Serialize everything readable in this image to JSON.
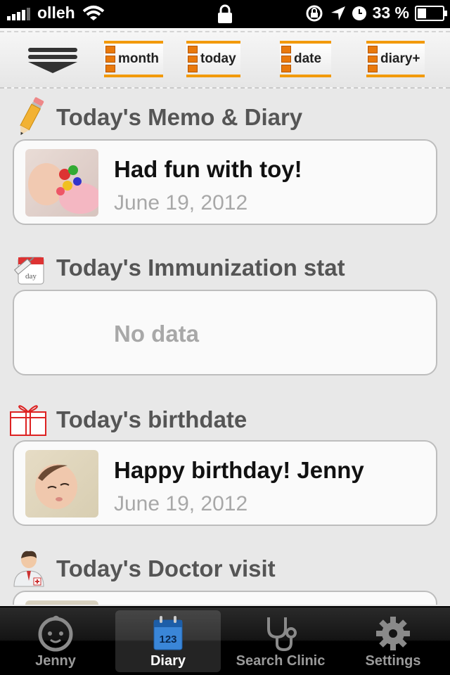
{
  "status_bar": {
    "carrier": "olleh",
    "battery": "33 %"
  },
  "toolbar": {
    "menu_icon": "menu-arrow-icon",
    "buttons": [
      {
        "label": "month"
      },
      {
        "label": "today"
      },
      {
        "label": "date"
      },
      {
        "label": "diary+"
      }
    ]
  },
  "sections": [
    {
      "title": "Today's Memo & Diary",
      "icon": "pencil-icon",
      "card": {
        "title": "Had fun with toy!",
        "date": "June 19, 2012"
      }
    },
    {
      "title": "Today's Immunization stat",
      "icon": "calendar-syringe-icon",
      "card": {
        "empty_text": "No data"
      }
    },
    {
      "title": "Today's birthdate",
      "icon": "gift-icon",
      "card": {
        "title": "Happy birthday! Jenny",
        "date": "June 19, 2012"
      }
    },
    {
      "title": "Today's Doctor visit",
      "icon": "doctor-icon"
    }
  ],
  "tabbar": {
    "tabs": [
      {
        "label": "Jenny",
        "icon": "baby-face-icon"
      },
      {
        "label": "Diary",
        "icon": "calendar-icon",
        "active": true
      },
      {
        "label": "Search Clinic",
        "icon": "stethoscope-icon"
      },
      {
        "label": "Settings",
        "icon": "gear-icon"
      }
    ]
  },
  "colors": {
    "accent_orange": "#f29a0c",
    "section_title": "#555555",
    "date_gray": "#a8a8a8"
  }
}
